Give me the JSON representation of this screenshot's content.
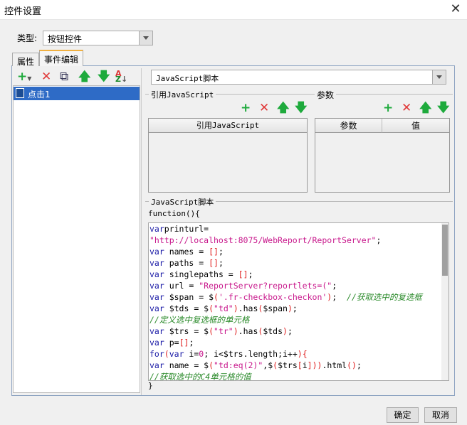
{
  "window": {
    "title": "控件设置",
    "close": "✕"
  },
  "type": {
    "label": "类型:",
    "value": "按钮控件"
  },
  "tabs": [
    {
      "label": "属性"
    },
    {
      "label": "事件编辑",
      "active": true
    }
  ],
  "events": {
    "items": [
      {
        "label": "点击1",
        "selected": true
      }
    ]
  },
  "script_type": {
    "value": "JavaScript脚本"
  },
  "ref_js": {
    "label": "引用JavaScript",
    "column": "引用JavaScript"
  },
  "params": {
    "label": "参数",
    "columns": [
      "参数",
      "值"
    ]
  },
  "script": {
    "label": "JavaScript脚本",
    "header": "function(){",
    "footer": "}",
    "lines": [
      [
        [
          "kw",
          "var"
        ],
        [
          "",
          "printurl="
        ]
      ],
      [
        [
          "st",
          "\"http://localhost:8075/WebReport/ReportServer\""
        ],
        [
          "",
          ";"
        ]
      ],
      [
        [
          "kw",
          "var"
        ],
        [
          "",
          " names = "
        ],
        [
          "br",
          "[]"
        ],
        [
          "",
          ";"
        ]
      ],
      [
        [
          "kw",
          "var"
        ],
        [
          "",
          " paths = "
        ],
        [
          "br",
          "[]"
        ],
        [
          "",
          ";"
        ]
      ],
      [
        [
          "kw",
          "var"
        ],
        [
          "",
          " singlepaths = "
        ],
        [
          "br",
          "[]"
        ],
        [
          "",
          ";"
        ]
      ],
      [
        [
          "kw",
          "var"
        ],
        [
          "",
          " url = "
        ],
        [
          "st",
          "\"ReportServer?reportlets=(\""
        ],
        [
          "",
          ";"
        ]
      ],
      [
        [
          "kw",
          "var"
        ],
        [
          "",
          " $span = $"
        ],
        [
          "br",
          "("
        ],
        [
          "st",
          "'.fr-checkbox-checkon'"
        ],
        [
          "br",
          ")"
        ],
        [
          "",
          ";  "
        ],
        [
          "cm",
          "//获取选中的复选框"
        ]
      ],
      [
        [
          "kw",
          "var"
        ],
        [
          "",
          " $tds = $"
        ],
        [
          "br",
          "("
        ],
        [
          "st",
          "\"td\""
        ],
        [
          "br",
          ")"
        ],
        [
          "",
          ".has"
        ],
        [
          "br",
          "("
        ],
        [
          "",
          "$span"
        ],
        [
          "br",
          ")"
        ],
        [
          "",
          ";"
        ]
      ],
      [
        [
          "cm",
          "//定义选中复选框的单元格"
        ]
      ],
      [
        [
          "kw",
          "var"
        ],
        [
          "",
          " $trs = $"
        ],
        [
          "br",
          "("
        ],
        [
          "st",
          "\"tr\""
        ],
        [
          "br",
          ")"
        ],
        [
          "",
          ".has"
        ],
        [
          "br",
          "("
        ],
        [
          "",
          "$tds"
        ],
        [
          "br",
          ")"
        ],
        [
          "",
          ";"
        ]
      ],
      [
        [
          "kw",
          "var"
        ],
        [
          "",
          " p="
        ],
        [
          "br",
          "[]"
        ],
        [
          "",
          ";"
        ]
      ],
      [
        [
          "kw",
          "for"
        ],
        [
          "br",
          "("
        ],
        [
          "kw",
          "var"
        ],
        [
          "",
          " i="
        ],
        [
          "nm",
          "0"
        ],
        [
          "",
          "; i<$trs.length;i++"
        ],
        [
          "br",
          ")"
        ],
        [
          "br",
          "{"
        ]
      ],
      [
        [
          "kw",
          "var"
        ],
        [
          "",
          " name = $"
        ],
        [
          "br",
          "("
        ],
        [
          "st",
          "\"td:eq(2)\""
        ],
        [
          "",
          ",$"
        ],
        [
          "br",
          "("
        ],
        [
          "",
          "$trs"
        ],
        [
          "br",
          "["
        ],
        [
          "",
          "i"
        ],
        [
          "br",
          "]"
        ],
        [
          "br",
          "))"
        ],
        [
          "",
          ".html"
        ],
        [
          "br",
          "()"
        ],
        [
          "",
          ";"
        ]
      ],
      [
        [
          "cm",
          "//获取选中的C4单元格的值"
        ]
      ]
    ]
  },
  "buttons": {
    "ok": "确定",
    "cancel": "取消"
  },
  "colors": {
    "selection": "#2e6bc6",
    "add": "#1eaa3c",
    "delete": "#e03a3a",
    "keyword": "#1a1aa6",
    "string": "#c8188c",
    "comment": "#2a8a2a"
  }
}
